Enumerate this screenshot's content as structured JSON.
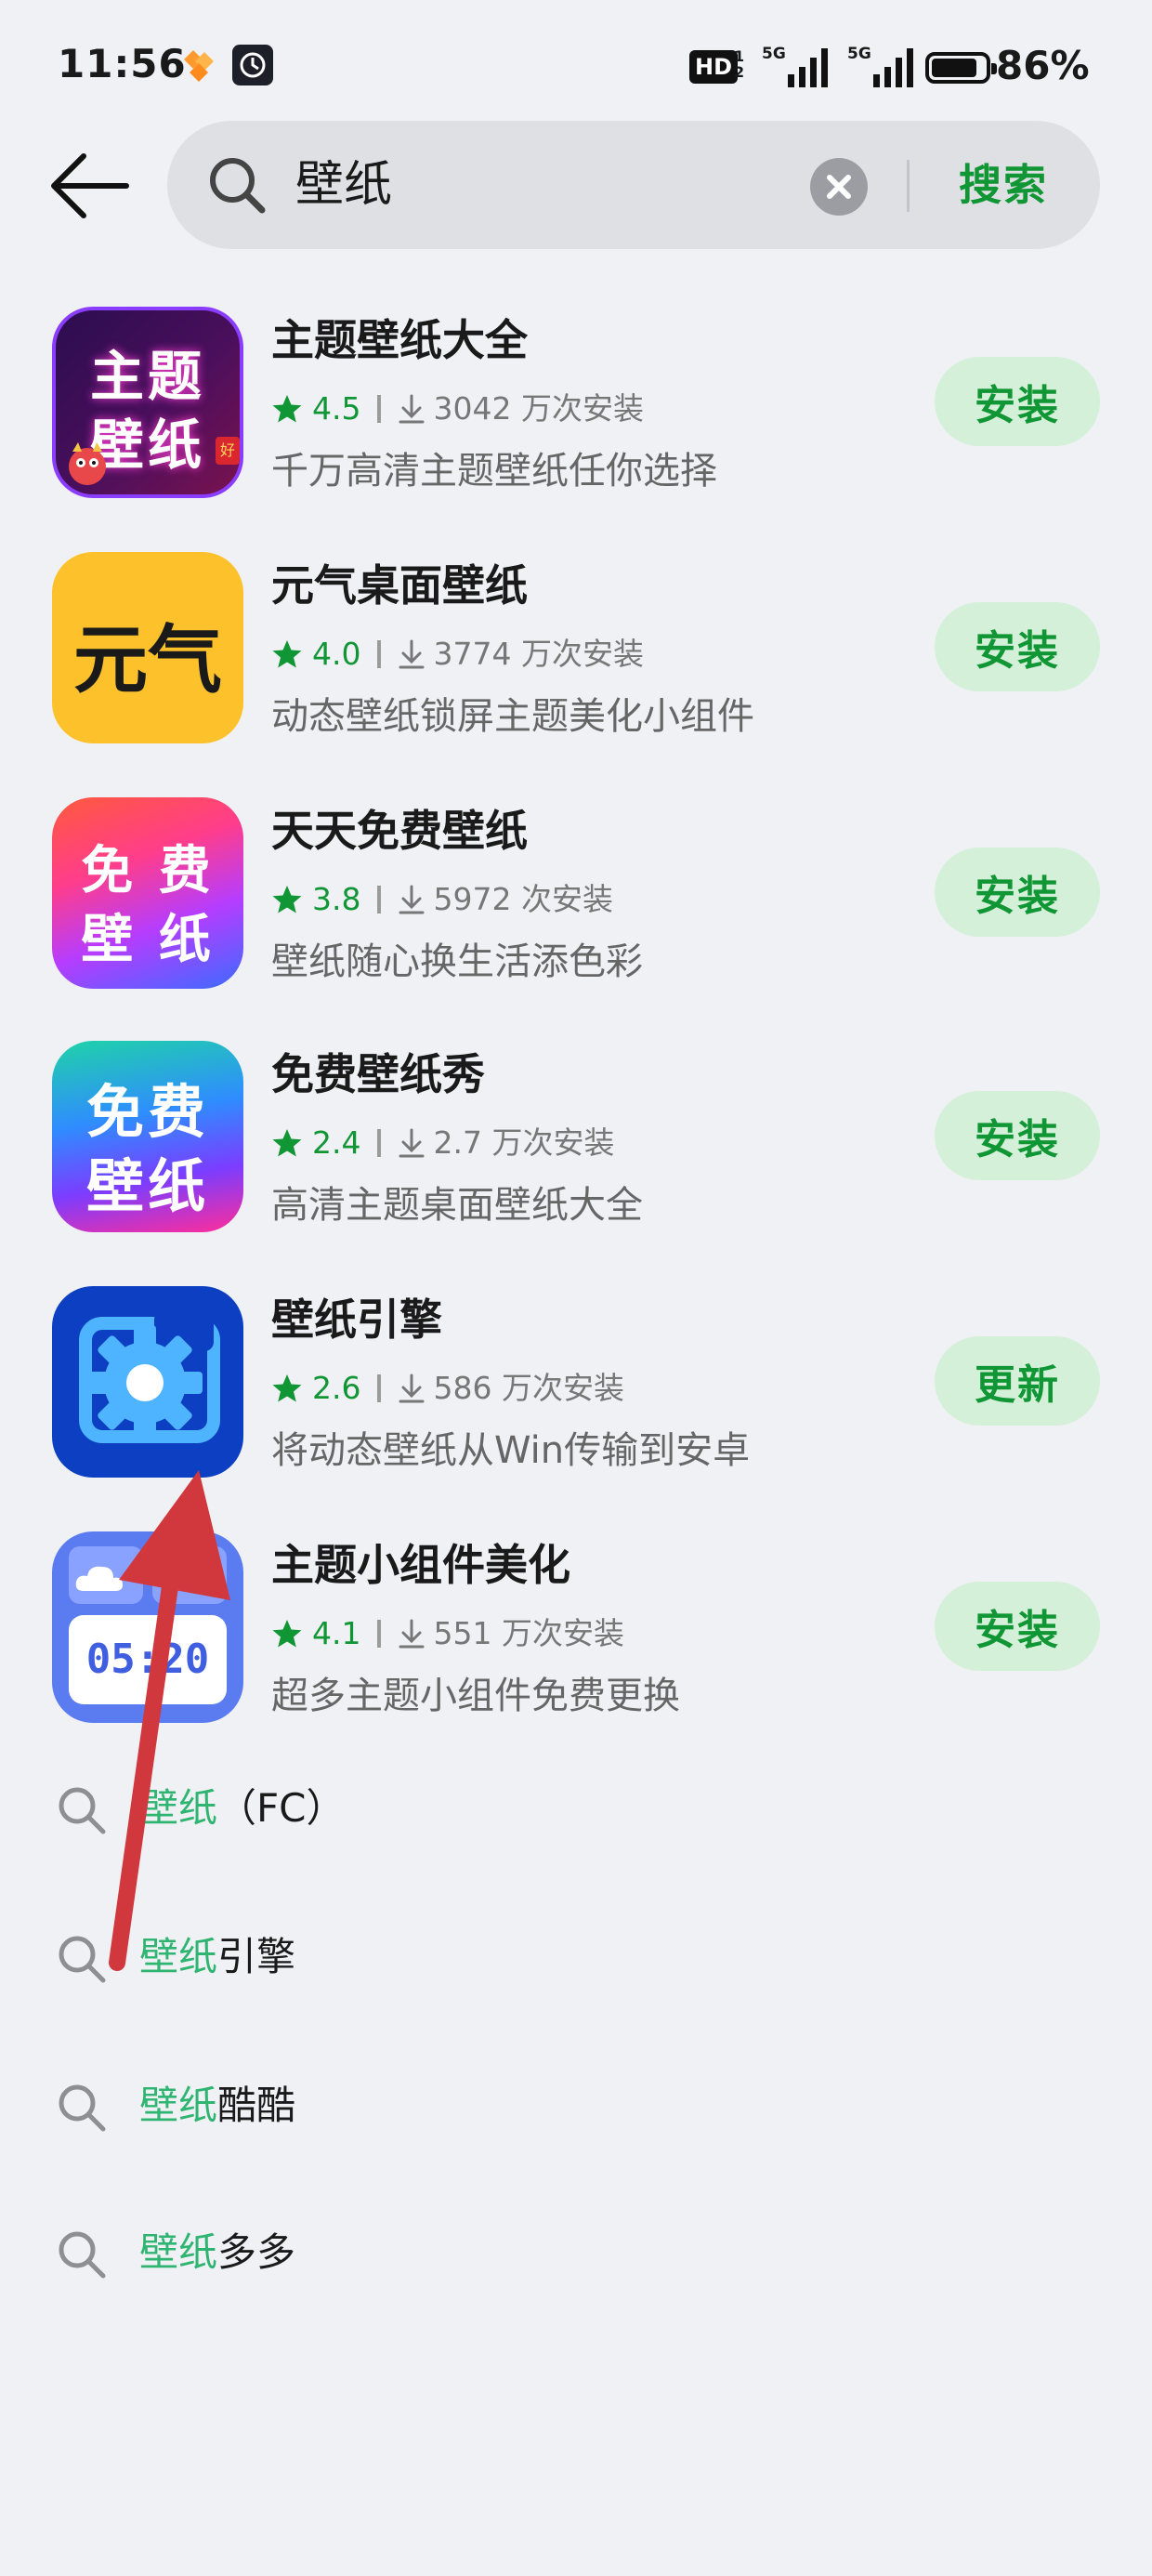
{
  "status_bar": {
    "time": "11:56",
    "hd_label": "HD",
    "hd_sub_top": "1",
    "hd_sub_bottom": "2",
    "net1_label": "5G",
    "net2_label": "5G",
    "battery_level": 0.86,
    "battery_text": "86%"
  },
  "search": {
    "query": "壁纸",
    "submit_label": "搜索",
    "accent_color": "#119635"
  },
  "results": [
    {
      "name": "主题壁纸大全",
      "rating": "4.5",
      "installs": "3042 万次安装",
      "description": "千万高清主题壁纸任你选择",
      "action": "安装",
      "icon": {
        "semantic": "app-icon-theme-wallpaper",
        "line1": "主题",
        "line2": "壁纸",
        "badge": "好"
      }
    },
    {
      "name": "元气桌面壁纸",
      "rating": "4.0",
      "installs": "3774 万次安装",
      "description": "动态壁纸锁屏主题美化小组件",
      "action": "安装",
      "icon": {
        "semantic": "app-icon-yuanqi",
        "line1": "元气"
      }
    },
    {
      "name": "天天免费壁纸",
      "rating": "3.8",
      "installs": "5972 次安装",
      "description": "壁纸随心换生活添色彩",
      "action": "安装",
      "icon": {
        "semantic": "app-icon-free-wallpaper-rainbow",
        "line1": "免 费",
        "line2": "壁 纸"
      }
    },
    {
      "name": "免费壁纸秀",
      "rating": "2.4",
      "installs": "2.7 万次安装",
      "description": "高清主题桌面壁纸大全",
      "action": "安装",
      "icon": {
        "semantic": "app-icon-free-wallpaper-show",
        "line1": "免费",
        "line2": "壁纸"
      }
    },
    {
      "name": "壁纸引擎",
      "rating": "2.6",
      "installs": "586 万次安装",
      "description": "将动态壁纸从Win传输到安卓",
      "action": "更新",
      "icon": {
        "semantic": "app-icon-wallpaper-engine"
      }
    },
    {
      "name": "主题小组件美化",
      "rating": "4.1",
      "installs": "551 万次安装",
      "description": "超多主题小组件免费更换",
      "action": "安装",
      "icon": {
        "semantic": "app-icon-widget-clock",
        "clock": "05:20"
      }
    }
  ],
  "suggestions": [
    {
      "highlight": "壁纸",
      "rest": "（FC）"
    },
    {
      "highlight": "壁纸",
      "rest": "引擎"
    },
    {
      "highlight": "壁纸",
      "rest": "酷酷"
    },
    {
      "highlight": "壁纸",
      "rest": "多多"
    }
  ],
  "colors": {
    "background": "#f0f1f5",
    "install_button_bg": "#d5f0d9",
    "suggestion_highlight": "#2fb571",
    "annotation_arrow": "#d0383d"
  }
}
